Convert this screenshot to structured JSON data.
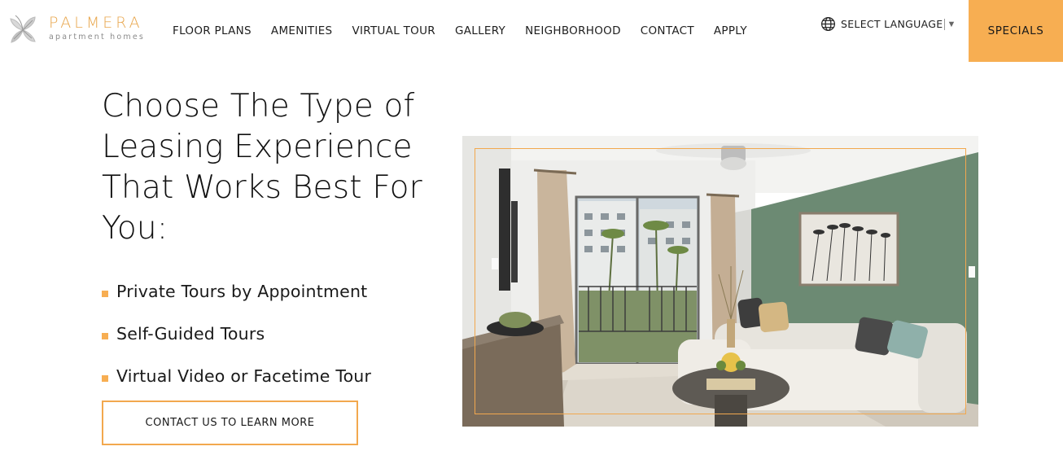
{
  "brand": {
    "name": "PALMERA",
    "tagline": "apartment homes",
    "accent_color": "#f7ae52"
  },
  "nav": {
    "items": [
      {
        "label": "FLOOR PLANS"
      },
      {
        "label": "AMENITIES"
      },
      {
        "label": "VIRTUAL TOUR"
      },
      {
        "label": "GALLERY"
      },
      {
        "label": "NEIGHBORHOOD"
      },
      {
        "label": "CONTACT"
      },
      {
        "label": "APPLY"
      }
    ]
  },
  "language": {
    "icon": "globe-icon",
    "label": "SELECT LANGUAGE",
    "caret": "▼"
  },
  "specials": {
    "label": "SPECIALS"
  },
  "main": {
    "heading": "Choose The Type of Leasing Experience That Works Best For You:",
    "features": [
      {
        "label": "Private Tours by Appointment"
      },
      {
        "label": "Self-Guided Tours"
      },
      {
        "label": "Virtual Video or Facetime Tour"
      }
    ],
    "cta_label": "CONTACT US TO LEARN MORE"
  }
}
